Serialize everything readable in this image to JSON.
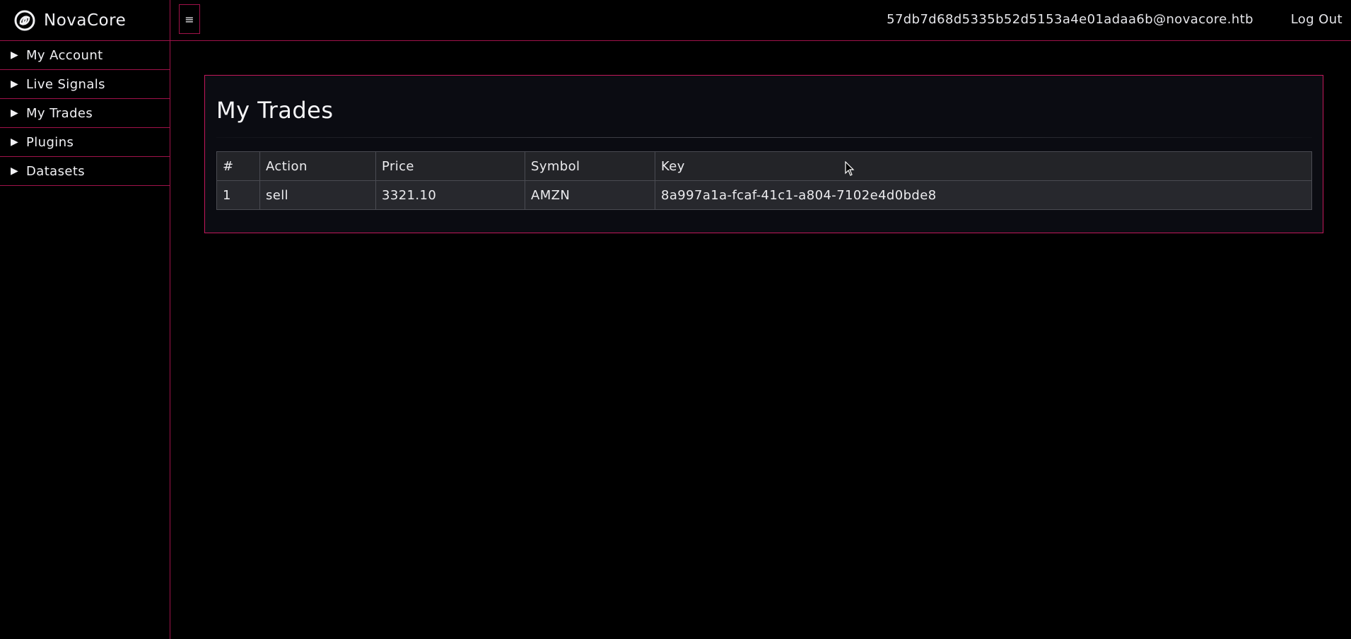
{
  "brand": {
    "name": "NovaCore",
    "logo_icon": "swirl-logo-icon"
  },
  "sidebar": {
    "items": [
      {
        "label": "My Account",
        "icon": "triangle-right-icon"
      },
      {
        "label": "Live Signals",
        "icon": "triangle-right-icon"
      },
      {
        "label": "My Trades",
        "icon": "triangle-right-icon"
      },
      {
        "label": "Plugins",
        "icon": "triangle-right-icon"
      },
      {
        "label": "Datasets",
        "icon": "triangle-right-icon"
      }
    ]
  },
  "topbar": {
    "menu_icon": "≡",
    "user_email": "57db7d68d5335b52d5153a4e01adaa6b@novacore.htb",
    "logout_label": "Log Out"
  },
  "main": {
    "title": "My Trades",
    "table": {
      "headers": [
        "#",
        "Action",
        "Price",
        "Symbol",
        "Key"
      ],
      "rows": [
        [
          "1",
          "sell",
          "3321.10",
          "AMZN",
          "8a997a1a-fcaf-41c1-a804-7102e4d0bde8"
        ]
      ]
    }
  },
  "colors": {
    "accent": "#c2185b",
    "border": "#a0124a",
    "background": "#000000",
    "card_background": "#0b0c12",
    "table_background": "#27282d"
  }
}
